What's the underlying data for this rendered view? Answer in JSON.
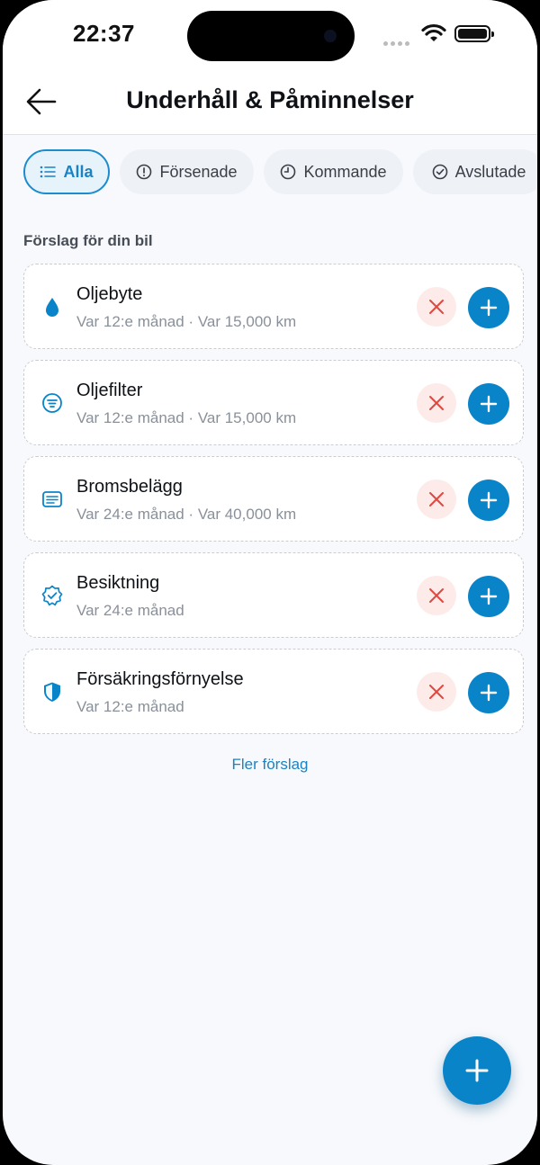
{
  "status_bar": {
    "time": "22:37"
  },
  "header": {
    "title": "Underhåll & Påminnelser"
  },
  "filters": [
    {
      "label": "Alla",
      "icon": "list-icon",
      "active": true
    },
    {
      "label": "Försenade",
      "icon": "alert-circle-icon",
      "active": false
    },
    {
      "label": "Kommande",
      "icon": "clock-icon",
      "active": false
    },
    {
      "label": "Avslutade",
      "icon": "check-circle-icon",
      "active": false
    }
  ],
  "suggestions": {
    "section_label": "Förslag för din bil",
    "items": [
      {
        "name": "Oljebyte",
        "meta": "Var 12:e månad · Var 15,000 km",
        "icon": "droplet-icon"
      },
      {
        "name": "Oljefilter",
        "meta": "Var 12:e månad · Var 15,000 km",
        "icon": "filter-icon"
      },
      {
        "name": "Bromsbelägg",
        "meta": "Var 24:e månad · Var 40,000 km",
        "icon": "brake-pad-icon"
      },
      {
        "name": "Besiktning",
        "meta": "Var 24:e månad",
        "icon": "verified-badge-icon"
      },
      {
        "name": "Försäkringsförnyelse",
        "meta": "Var 12:e månad",
        "icon": "shield-icon"
      }
    ],
    "more_label": "Fler förslag"
  },
  "colors": {
    "accent": "#0a84c8",
    "dismiss_bg": "#fdebea",
    "dismiss_icon": "#e0473f",
    "background": "#f7f9fc"
  }
}
